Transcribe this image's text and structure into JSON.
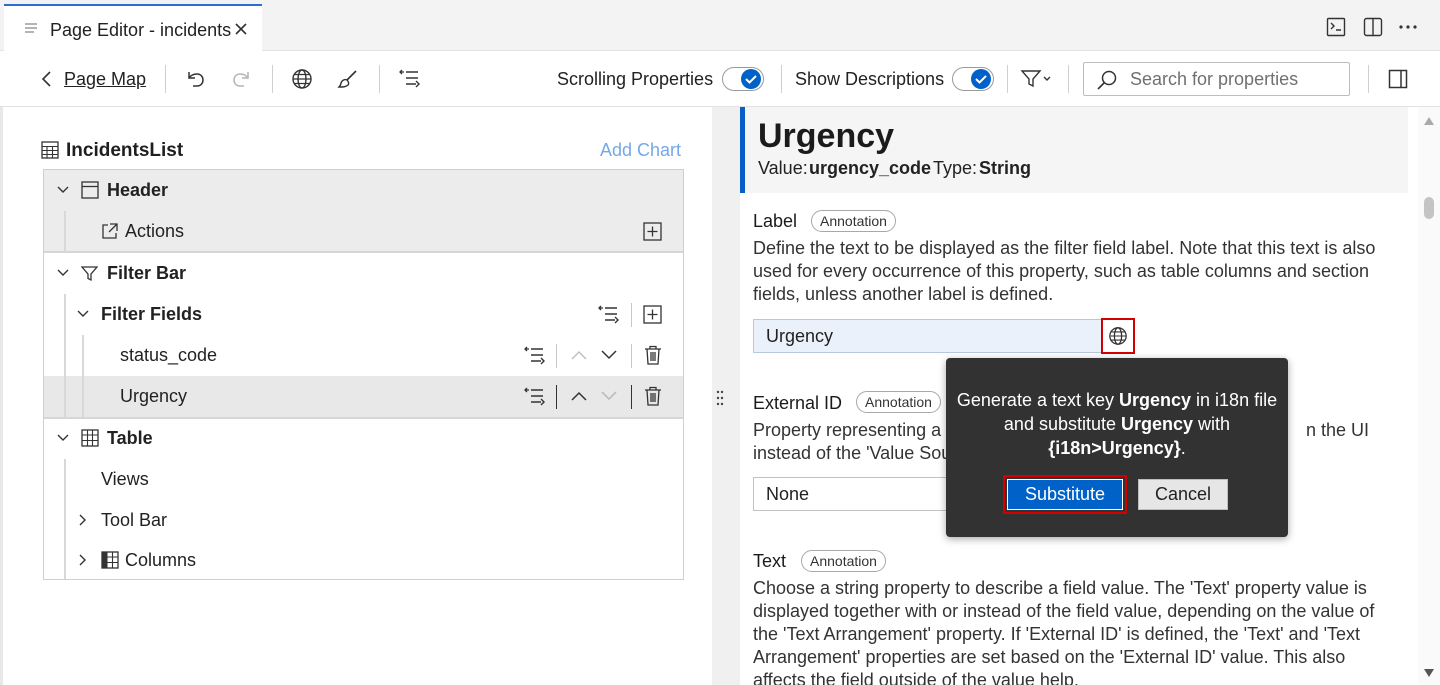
{
  "tab": {
    "title": "Page Editor - incidents"
  },
  "toolbar": {
    "page_map_label": "Page Map",
    "scrolling_properties_label": "Scrolling Properties",
    "show_descriptions_label": "Show Descriptions",
    "search_placeholder": "Search for properties"
  },
  "outline": {
    "title": "IncidentsList",
    "add_chart": "Add Chart",
    "header": "Header",
    "actions": "Actions",
    "filter_bar": "Filter Bar",
    "filter_fields": "Filter Fields",
    "status_code": "status_code",
    "urgency": "Urgency",
    "table": "Table",
    "views": "Views",
    "tool_bar": "Tool Bar",
    "columns": "Columns"
  },
  "property": {
    "title": "Urgency",
    "value_label": "Value:",
    "value": "urgency_code",
    "type_label": "Type:",
    "type": "String",
    "label_section": {
      "title": "Label",
      "badge": "Annotation",
      "description": "Define the text to be displayed as the filter field label. Note that this text is also used for every occurrence of this property, such as table columns and section fields, unless another label is defined.",
      "value": "Urgency"
    },
    "external_id_section": {
      "title": "External ID",
      "badge": "Annotation",
      "desc_line1_a": "Property representing a h",
      "desc_line1_b": "n the UI",
      "desc_line2": "instead of the 'Value Sou",
      "value": "None"
    },
    "text_section": {
      "title": "Text",
      "badge": "Annotation",
      "description": "Choose a string property to describe a field value. The 'Text' property value is displayed together with or instead of the field value, depending on the value of the 'Text Arrangement' property. If 'External ID' is defined, the 'Text' and 'Text Arrangement' properties are set based on the 'External ID' value. This also affects the field outside of the value help."
    }
  },
  "popover": {
    "t1": "Generate a text key ",
    "t2": "Urgency",
    "t3": " in i18n file and substitute ",
    "t4": "Urgency",
    "t5": " with ",
    "t6": "{i18n>Urgency}",
    "t7": ".",
    "substitute_label": "Substitute",
    "cancel_label": "Cancel"
  },
  "colors": {
    "accent": "#0062c8",
    "highlight_border": "#d40000",
    "popover_bg": "#323232"
  }
}
